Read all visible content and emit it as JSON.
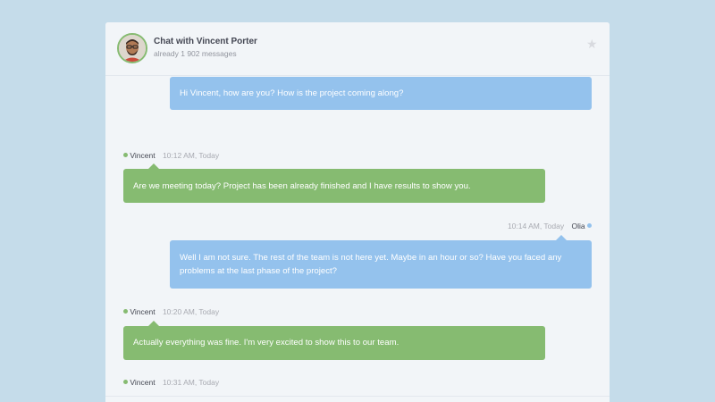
{
  "header": {
    "title": "Chat with Vincent Porter",
    "subtitle": "already 1 902 messages",
    "avatar_icon": "avatar-vincent",
    "star_icon": "star-icon"
  },
  "colors": {
    "background": "#c5dcea",
    "panel": "#f2f5f8",
    "other_bubble": "#86bb71",
    "my_bubble": "#94c2ed",
    "online": "#86bb71",
    "me": "#94c2ed"
  },
  "messages": [
    {
      "from": "me",
      "text": "Hi Vincent, how are you? How is the project coming along?"
    },
    {
      "from": "Vincent",
      "time": "10:12 AM, Today",
      "text": "Are we meeting today? Project has been already finished and I have results to show you."
    },
    {
      "from": "Olia",
      "time": "10:14 AM, Today",
      "text": "Well I am not sure. The rest of the team is not here yet. Maybe in an hour or so? Have you faced any problems at the last phase of the project?"
    },
    {
      "from": "Vincent",
      "time": "10:20 AM, Today",
      "text": "Actually everything was fine. I'm very excited to show this to our team."
    },
    {
      "from": "Vincent",
      "time": "10:31 AM, Today",
      "text": ""
    }
  ]
}
